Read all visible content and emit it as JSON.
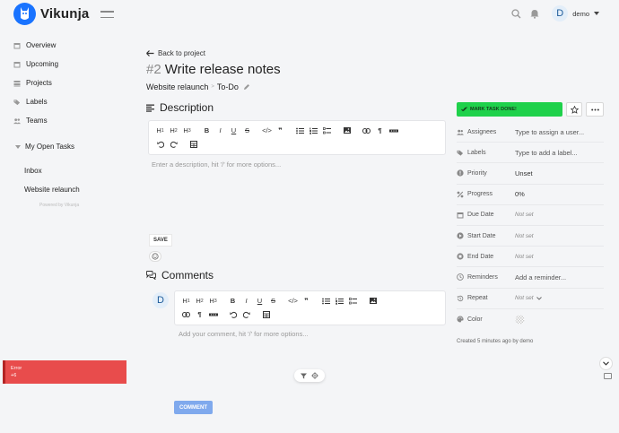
{
  "app": {
    "name": "Vikunja"
  },
  "user": {
    "initial": "D",
    "name": "demo"
  },
  "nav": {
    "items": [
      {
        "label": "Overview",
        "icon": "calendar-icon"
      },
      {
        "label": "Upcoming",
        "icon": "calendar-icon"
      },
      {
        "label": "Projects",
        "icon": "layers-icon"
      },
      {
        "label": "Labels",
        "icon": "tags-icon"
      },
      {
        "label": "Teams",
        "icon": "users-icon"
      }
    ],
    "section": "My Open Tasks",
    "projects": [
      "Inbox",
      "Website relaunch"
    ],
    "powered_by": "Powered by Vikunja"
  },
  "error": {
    "title": "Error",
    "detail": "+6"
  },
  "task": {
    "back_label": "Back to project",
    "number": "#2",
    "title": "Write release notes",
    "project": "Website relaunch",
    "bucket": "To-Do",
    "crumb_sep": ">"
  },
  "description": {
    "heading": "Description",
    "placeholder": "Enter a description, hit '/' for more options...",
    "save_label": "SAVE"
  },
  "comments": {
    "heading": "Comments",
    "avatar_initial": "D",
    "placeholder": "Add your comment, hit '/' for more options...",
    "button_label": "COMMENT"
  },
  "toolbar": {
    "h1": "H",
    "h2": "H",
    "h3": "H",
    "h1_sub": "1",
    "h2_sub": "2",
    "h3_sub": "3",
    "bold": "B",
    "italic": "I",
    "underline": "U",
    "strike": "S",
    "code": "</>",
    "quote": "❞",
    "paragraph": "¶"
  },
  "sidebar_right": {
    "done_label": "MARK TASK DONE!",
    "props": [
      {
        "label": "Assignees",
        "value": "Type to assign a user...",
        "icon": "users-icon",
        "style": "placeholder"
      },
      {
        "label": "Labels",
        "value": "Type to add a label...",
        "icon": "tags-icon",
        "style": "placeholder"
      },
      {
        "label": "Priority",
        "value": "Unset",
        "icon": "exclamation-icon",
        "style": ""
      },
      {
        "label": "Progress",
        "value": "0%",
        "icon": "percent-icon",
        "style": ""
      },
      {
        "label": "Due Date",
        "value": "Not set",
        "icon": "calendar-icon",
        "style": "muted"
      },
      {
        "label": "Start Date",
        "value": "Not set",
        "icon": "play-icon",
        "style": "muted"
      },
      {
        "label": "End Date",
        "value": "Not set",
        "icon": "stop-icon",
        "style": "muted"
      },
      {
        "label": "Reminders",
        "value": "Add a reminder...",
        "icon": "clock-icon",
        "style": "placeholder"
      },
      {
        "label": "Repeat",
        "value": "Not set",
        "icon": "history-icon",
        "style": "muted"
      },
      {
        "label": "Color",
        "value": "",
        "icon": "palette-icon",
        "style": ""
      }
    ],
    "created": "Created 5 minutes ago by demo"
  },
  "colors": {
    "accent": "#1973ff",
    "done": "#1fd14b",
    "error": "#e84c4c",
    "comment_btn": "#7fa9ed"
  }
}
